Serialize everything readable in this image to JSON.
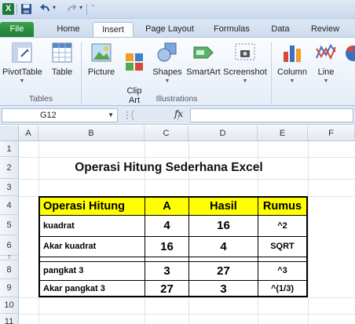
{
  "app": {
    "logo": "X"
  },
  "ribbon_tabs": [
    "File",
    "Home",
    "Insert",
    "Page Layout",
    "Formulas",
    "Data",
    "Review"
  ],
  "ribbon": {
    "buttons": [
      {
        "label": "PivotTable",
        "icon": "pivottable-icon"
      },
      {
        "label": "Table",
        "icon": "table-icon"
      },
      {
        "label": "Picture",
        "icon": "picture-icon"
      },
      {
        "label": "Clip\nArt",
        "icon": "clipart-icon"
      },
      {
        "label": "Shapes",
        "icon": "shapes-icon"
      },
      {
        "label": "SmartArt",
        "icon": "smartart-icon"
      },
      {
        "label": "Screenshot",
        "icon": "screenshot-icon"
      },
      {
        "label": "Column",
        "icon": "column-chart-icon"
      },
      {
        "label": "Line",
        "icon": "line-chart-icon"
      }
    ],
    "groups": {
      "tables": "Tables",
      "illustrations": "Illustrations"
    }
  },
  "formula_bar": {
    "name_box": "G12",
    "fx": "fx",
    "formula": ""
  },
  "columns": [
    "A",
    "B",
    "C",
    "D",
    "E",
    "F"
  ],
  "rows": [
    "1",
    "2",
    "3",
    "4",
    "5",
    "6",
    "7",
    "8",
    "9",
    "10",
    "11"
  ],
  "sheet": {
    "title": "Operasi Hitung Sederhana Excel",
    "headers": [
      "Operasi Hitung",
      "A",
      "Hasil",
      "Rumus"
    ],
    "rows": [
      {
        "op": "kuadrat",
        "a": "4",
        "hasil": "16",
        "rumus": "^2"
      },
      {
        "op": "Akar kuadrat",
        "a": "16",
        "hasil": "4",
        "rumus": "SQRT"
      },
      {
        "op": "pangkat 3",
        "a": "3",
        "hasil": "27",
        "rumus": "^3"
      },
      {
        "op": "Akar pangkat 3",
        "a": "27",
        "hasil": "3",
        "rumus": "^(1/3)"
      }
    ]
  },
  "colors": {
    "header_fill": "#ffff00",
    "file_tab": "#2a8c3e"
  }
}
